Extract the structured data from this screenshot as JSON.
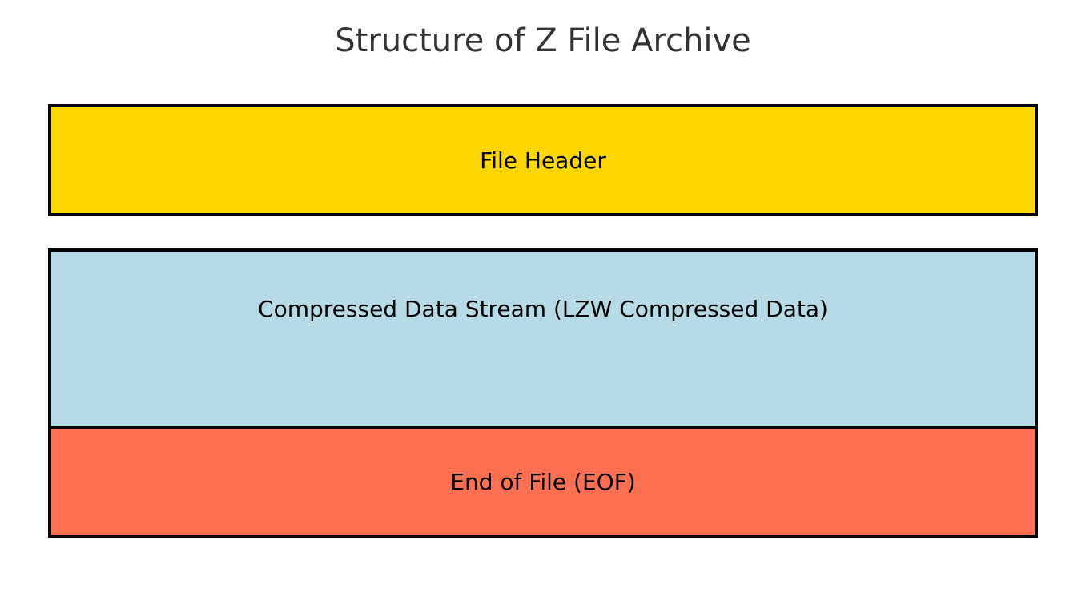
{
  "title": "Structure of Z File Archive",
  "blocks": {
    "header": "File Header",
    "data": "Compressed Data Stream (LZW Compressed Data)",
    "eof": "End of File (EOF)"
  }
}
